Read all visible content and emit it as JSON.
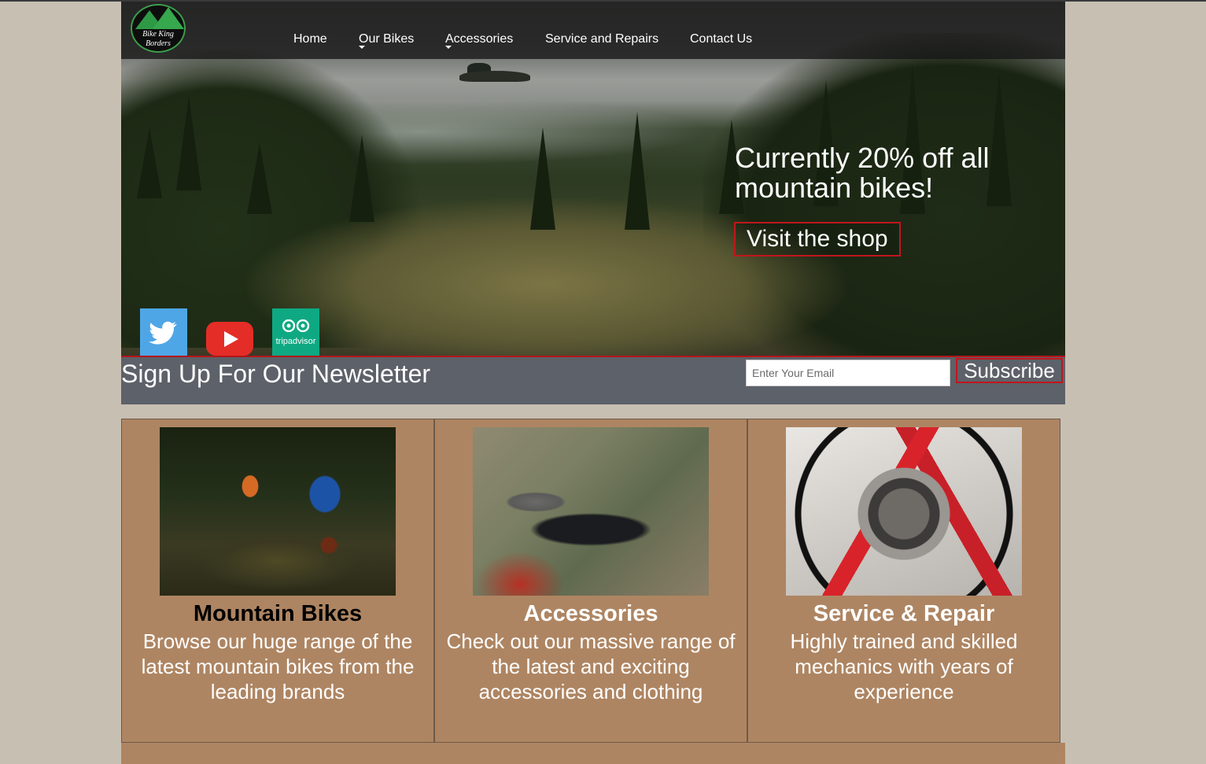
{
  "brand": {
    "logo_line1": "Bike King",
    "logo_line2": "Borders"
  },
  "nav": {
    "items": [
      {
        "label": "Home",
        "has_dropdown": false
      },
      {
        "label": "Our Bikes",
        "has_dropdown": true
      },
      {
        "label": "Accessories",
        "has_dropdown": true
      },
      {
        "label": "Service and Repairs",
        "has_dropdown": false
      },
      {
        "label": "Contact Us",
        "has_dropdown": false
      }
    ]
  },
  "hero": {
    "promo": "Currently 20% off all mountain bikes!",
    "cta_label": "Visit the shop"
  },
  "social": {
    "icons": [
      "twitter-icon",
      "youtube-icon",
      "tripadvisor-icon"
    ],
    "tripadvisor_label": "tripadvisor"
  },
  "newsletter": {
    "title": "Sign Up For Our Newsletter",
    "email_placeholder": "Enter Your Email",
    "email_value": "",
    "subscribe_label": "Subscribe"
  },
  "cards": [
    {
      "title": "Mountain Bikes",
      "title_color": "#000000",
      "text": "Browse our huge range of the latest mountain bikes from the leading brands"
    },
    {
      "title": "Accessories",
      "title_color": "#ffffff",
      "text": "Check out our massive range of the latest and exciting accessories and clothing"
    },
    {
      "title": "Service & Repair",
      "title_color": "#ffffff",
      "text": "Highly trained and skilled mechanics with years of experience"
    }
  ],
  "colors": {
    "background": "#c8bfb3",
    "card": "#ae8562",
    "newsletter_bar": "#5d6169",
    "accent_red": "#c0161c",
    "nav_bar": "#161616"
  }
}
